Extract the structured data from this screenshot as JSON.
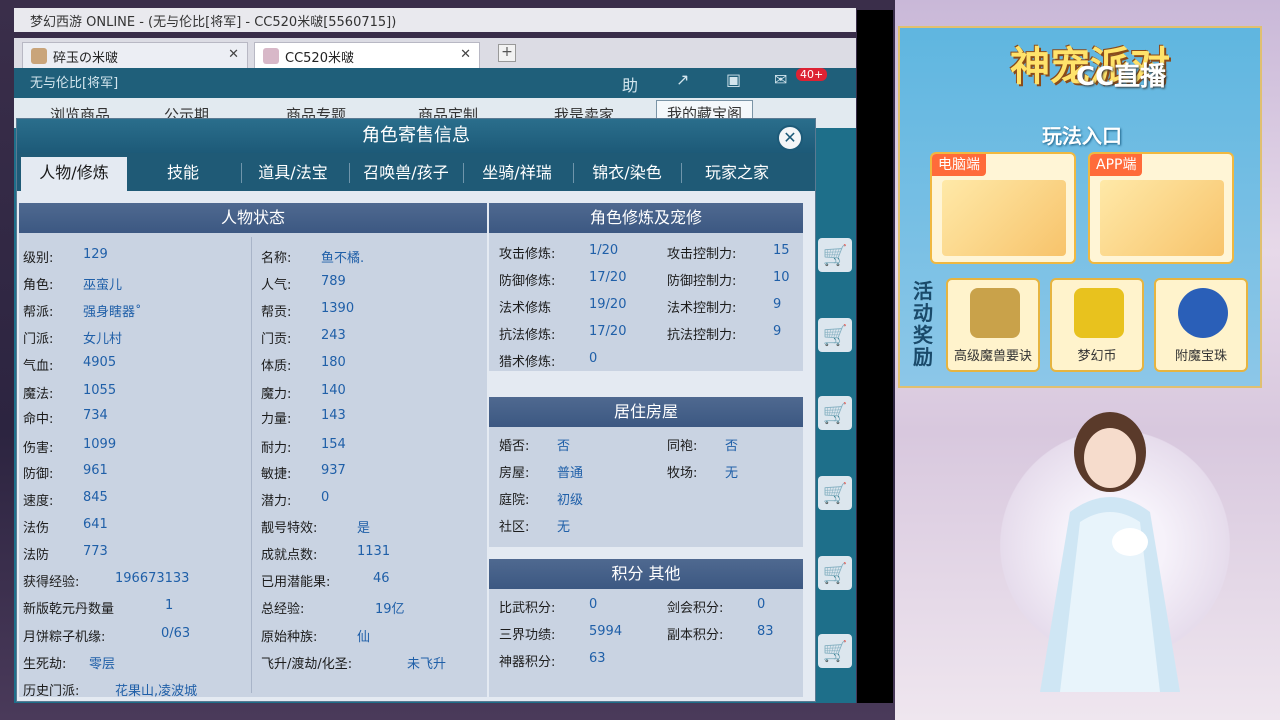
{
  "window": {
    "title": "梦幻西游 ONLINE - (无与伦比[将军] - CC520米啵[5560715])",
    "tabs": [
      {
        "label": "碎玉の米啵"
      },
      {
        "label": "CC520米啵"
      }
    ],
    "plus": "+"
  },
  "game": {
    "top_text": "无与伦比[将军]",
    "help_label": "助",
    "badge": "40+",
    "nav": [
      "浏览商品",
      "公示期",
      "商品专题",
      "商品定制",
      "我是卖家",
      "我的藏宝阁"
    ]
  },
  "dialog": {
    "title": "角色寄售信息",
    "close": "✕",
    "tabs": [
      "人物/修炼",
      "技能",
      "道具/法宝",
      "召唤兽/孩子",
      "坐骑/祥瑞",
      "锦衣/染色",
      "玩家之家"
    ],
    "status": {
      "title": "人物状态",
      "left": [
        {
          "label": "级别:",
          "value": "129"
        },
        {
          "label": "角色:",
          "value": "巫蛮儿"
        },
        {
          "label": "帮派:",
          "value": "强身瞎器˚"
        },
        {
          "label": "门派:",
          "value": "女儿村"
        },
        {
          "label": "气血:",
          "value": "4905"
        },
        {
          "label": "魔法:",
          "value": "1055"
        },
        {
          "label": "命中:",
          "value": "734"
        },
        {
          "label": "伤害:",
          "value": "1099"
        },
        {
          "label": "防御:",
          "value": "961"
        },
        {
          "label": "速度:",
          "value": "845"
        },
        {
          "label": "法伤",
          "value": "641"
        },
        {
          "label": "法防",
          "value": "773"
        },
        {
          "label": "获得经验:",
          "value": "196673133"
        },
        {
          "label": "新版乾元丹数量",
          "value": "1"
        },
        {
          "label": "月饼粽子机缘:",
          "value": "0/63"
        },
        {
          "label": "生死劫:",
          "value": "零层"
        },
        {
          "label": "历史门派:",
          "value": "花果山,凌波城"
        }
      ],
      "right": [
        {
          "label": "名称:",
          "value": "鱼不橘."
        },
        {
          "label": "人气:",
          "value": "789"
        },
        {
          "label": "帮贡:",
          "value": "1390"
        },
        {
          "label": "门贡:",
          "value": "243"
        },
        {
          "label": "体质:",
          "value": "180"
        },
        {
          "label": "魔力:",
          "value": "140"
        },
        {
          "label": "力量:",
          "value": "143"
        },
        {
          "label": "耐力:",
          "value": "154"
        },
        {
          "label": "敏捷:",
          "value": "937"
        },
        {
          "label": "潜力:",
          "value": "0"
        },
        {
          "label": "靓号特效:",
          "value": "是"
        },
        {
          "label": "成就点数:",
          "value": "1131"
        },
        {
          "label": "已用潜能果:",
          "value": "46"
        },
        {
          "label": "总经验:",
          "value": "19亿"
        },
        {
          "label": "原始种族:",
          "value": "仙"
        },
        {
          "label": "飞升/渡劫/化圣:",
          "value": "未飞升"
        }
      ]
    },
    "cultivation": {
      "title": "角色修炼及宠修",
      "left": [
        {
          "label": "攻击修炼:",
          "value": "1/20"
        },
        {
          "label": "防御修炼:",
          "value": "17/20"
        },
        {
          "label": "法术修炼",
          "value": "19/20"
        },
        {
          "label": "抗法修炼:",
          "value": "17/20"
        },
        {
          "label": "猎术修炼:",
          "value": "0"
        }
      ],
      "right": [
        {
          "label": "攻击控制力:",
          "value": "15"
        },
        {
          "label": "防御控制力:",
          "value": "10"
        },
        {
          "label": "法术控制力:",
          "value": "9"
        },
        {
          "label": "抗法控制力:",
          "value": "9"
        }
      ]
    },
    "house": {
      "title": "居住房屋",
      "left": [
        {
          "label": "婚否:",
          "value": "否"
        },
        {
          "label": "房屋:",
          "value": "普通"
        },
        {
          "label": "庭院:",
          "value": "初级"
        },
        {
          "label": "社区:",
          "value": "无"
        }
      ],
      "right": [
        {
          "label": "同袍:",
          "value": "否"
        },
        {
          "label": "牧场:",
          "value": "无"
        }
      ]
    },
    "score": {
      "title": "积分 其他",
      "left": [
        {
          "label": "比武积分:",
          "value": "0"
        },
        {
          "label": "三界功绩:",
          "value": "5994"
        },
        {
          "label": "神器积分:",
          "value": "63"
        }
      ],
      "right": [
        {
          "label": "剑会积分:",
          "value": "0"
        },
        {
          "label": "副本积分:",
          "value": "83"
        }
      ]
    }
  },
  "ad": {
    "title": "神宠派对",
    "cc_logo": "CC直播",
    "play_entry": "玩法入口",
    "pc_tag": "电脑端",
    "app_tag": "APP端",
    "reward_side": "活动奖励",
    "rewards": [
      {
        "name": "高级魔兽要诀",
        "color": "#c9a24a"
      },
      {
        "name": "梦幻币",
        "color": "#e8c21e"
      },
      {
        "name": "附魔宝珠",
        "color": "#2a5fb8"
      }
    ]
  }
}
